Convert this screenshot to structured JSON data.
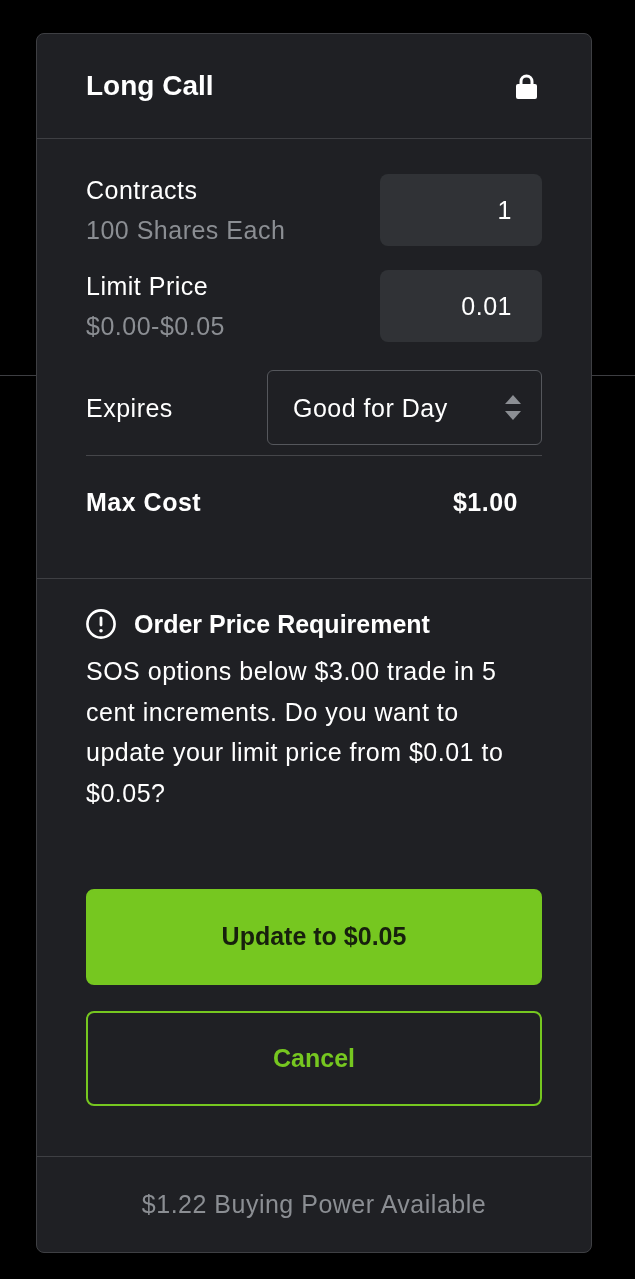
{
  "header": {
    "title": "Long Call"
  },
  "fields": [
    {
      "kind": "number",
      "label": "Contracts",
      "hint": "100 Shares Each",
      "value": "1"
    },
    {
      "kind": "number",
      "label": "Limit Price",
      "hint": "$0.00-$0.05",
      "value": "0.01"
    },
    {
      "kind": "select",
      "label": "Expires",
      "value": "Good for Day"
    }
  ],
  "summary": {
    "label": "Max Cost",
    "value": "$1.00"
  },
  "alert": {
    "title": "Order Price Requirement",
    "message": "SOS options below $3.00 trade in 5 cent increments. Do you want to update your limit price from $0.01 to $0.05?"
  },
  "buttons": [
    {
      "kind": "primary",
      "label": "Update to $0.05"
    },
    {
      "kind": "outline",
      "label": "Cancel"
    }
  ],
  "footer": {
    "text": "$1.22 Buying Power Available"
  }
}
